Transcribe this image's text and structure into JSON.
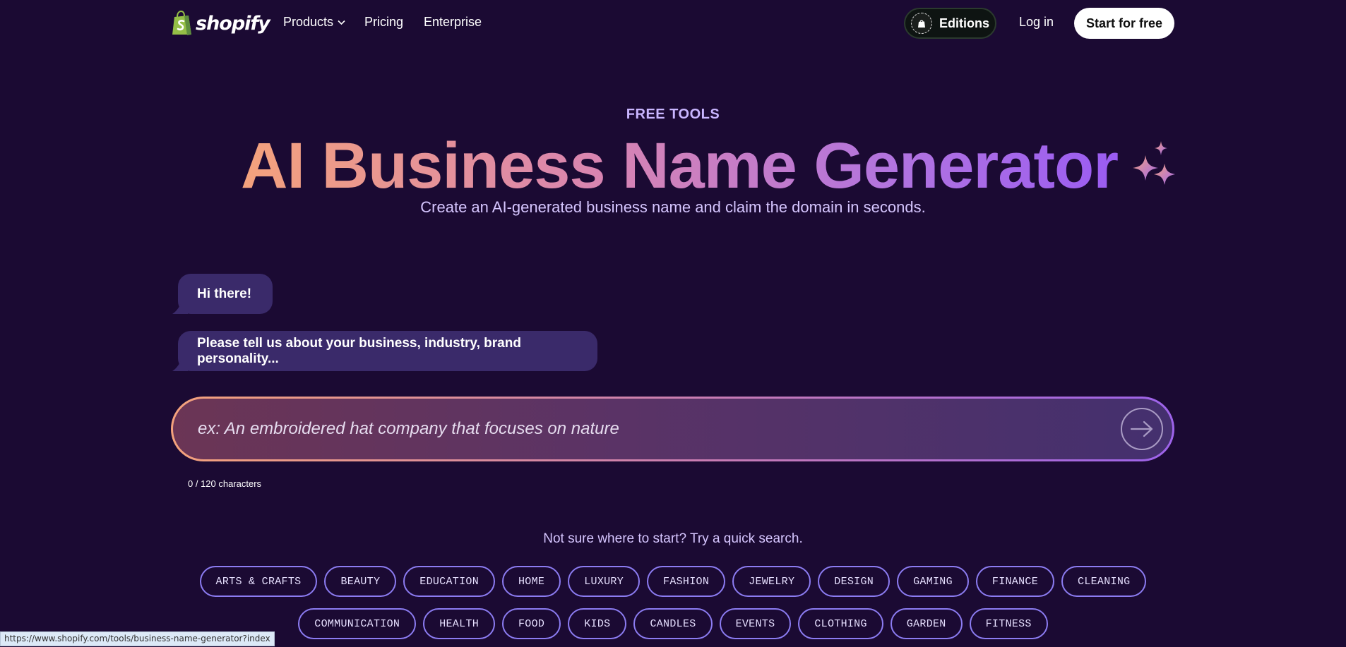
{
  "nav": {
    "logo_text": "shopify",
    "links": {
      "products": "Products",
      "pricing": "Pricing",
      "enterprise": "Enterprise"
    },
    "editions_label": "Editions",
    "login_label": "Log in",
    "start_label": "Start for free"
  },
  "hero": {
    "eyebrow": "FREE TOOLS",
    "title": "AI Business Name Generator",
    "subtitle": "Create an AI-generated business name and claim the domain in seconds."
  },
  "chat": {
    "greeting": "Hi there!",
    "prompt": "Please tell us about your business, industry, brand personality..."
  },
  "input": {
    "value": "",
    "placeholder": "ex: An embroidered hat company that focuses on nature",
    "char_count": "0 / 120 characters"
  },
  "quick_search": {
    "title": "Not sure where to start? Try a quick search.",
    "row1": [
      "ARTS & CRAFTS",
      "BEAUTY",
      "EDUCATION",
      "HOME",
      "LUXURY",
      "FASHION",
      "JEWELRY",
      "DESIGN",
      "GAMING",
      "FINANCE",
      "CLEANING"
    ],
    "row2": [
      "COMMUNICATION",
      "HEALTH",
      "FOOD",
      "KIDS",
      "CANDLES",
      "EVENTS",
      "CLOTHING",
      "GARDEN",
      "FITNESS"
    ]
  },
  "status_url": "https://www.shopify.com/tools/business-name-generator?index",
  "colors": {
    "background": "#1b0a33",
    "bubble": "#3a2a6a",
    "chip_border": "#8c7cf2",
    "gradient_start": "#f4a27c",
    "gradient_end": "#9a5cf2",
    "shopify_green": "#95bf47"
  },
  "icons": [
    "shopify-bag-icon",
    "chevron-down-icon",
    "editions-badge-icon",
    "sparkle-icon",
    "arrow-right-icon"
  ]
}
